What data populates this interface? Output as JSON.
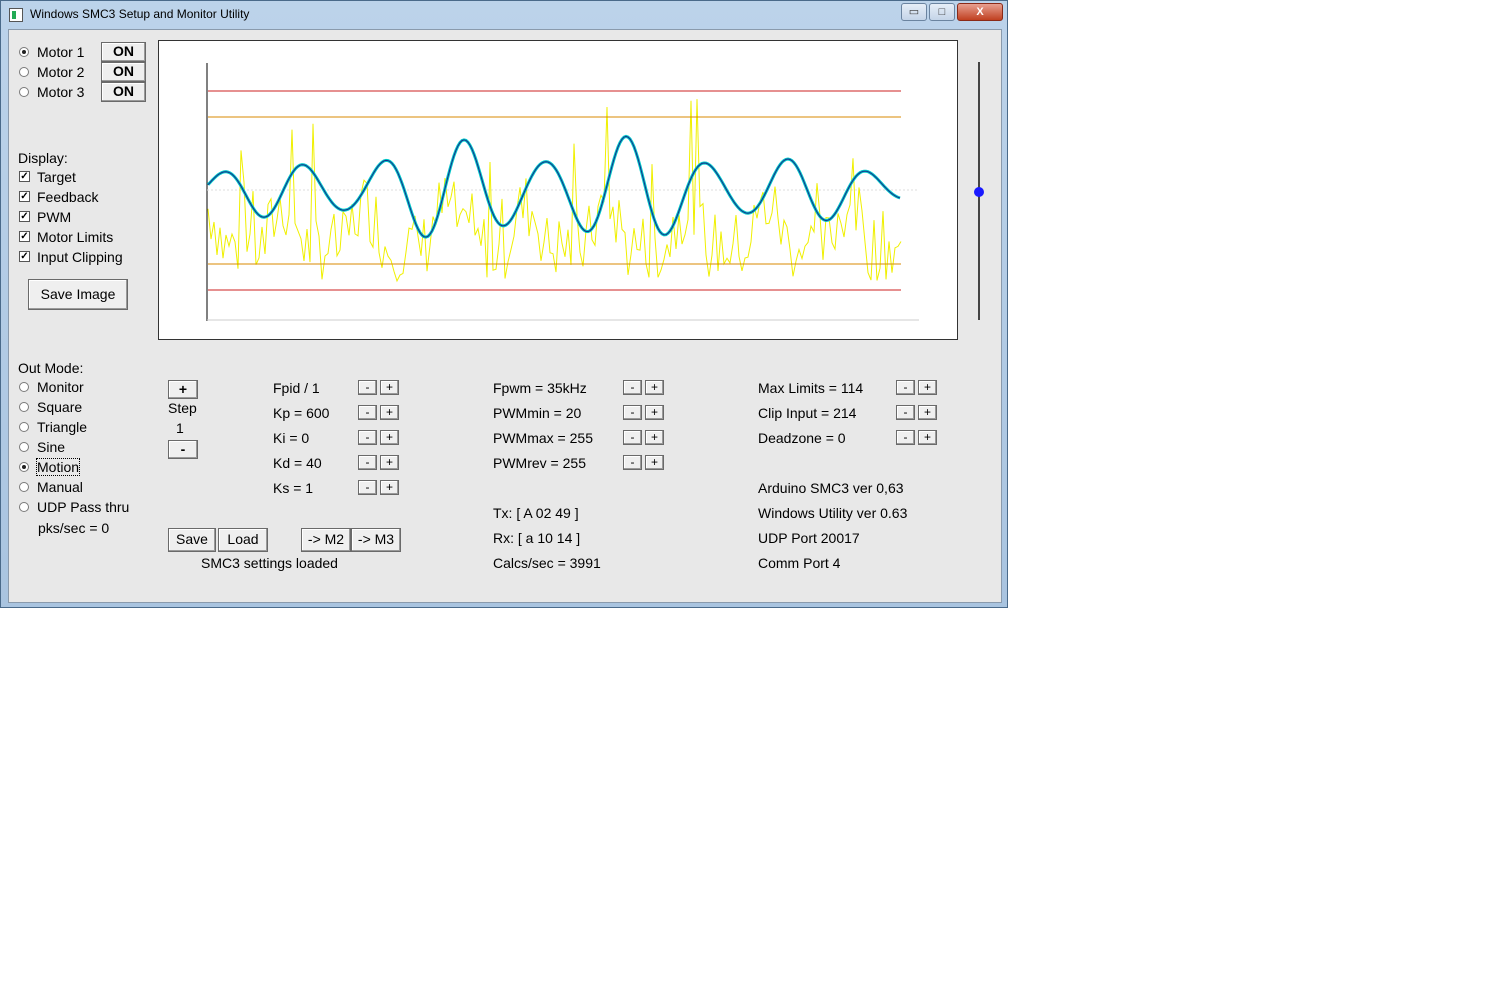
{
  "window": {
    "title": "Windows SMC3 Setup and Monitor Utility",
    "minimize": "▭",
    "maximize": "□",
    "close": "X"
  },
  "motors": [
    {
      "label": "Motor 1",
      "selected": true,
      "button": "ON"
    },
    {
      "label": "Motor 2",
      "selected": false,
      "button": "ON"
    },
    {
      "label": "Motor 3",
      "selected": false,
      "button": "ON"
    }
  ],
  "display": {
    "heading": "Display:",
    "options": [
      "Target",
      "Feedback",
      "PWM",
      "Motor Limits",
      "Input Clipping"
    ],
    "check_mark": "✓",
    "save_image": "Save Image"
  },
  "out_mode": {
    "heading": "Out Mode:",
    "options": [
      "Monitor",
      "Square",
      "Triangle",
      "Sine",
      "Motion",
      "Manual",
      "UDP Pass thru"
    ],
    "selected": "Motion",
    "pks": "pks/sec = 0"
  },
  "step": {
    "plus": "+",
    "label": "Step",
    "value": "1",
    "minus": "-"
  },
  "pid": [
    "Fpid / 1",
    "Kp = 600",
    "Ki = 0",
    "Kd = 40",
    "Ks = 1"
  ],
  "pwm": [
    "Fpwm = 35kHz",
    "PWMmin = 20",
    "PWMmax = 255",
    "PWMrev = 255"
  ],
  "limits": [
    "Max Limits = 114",
    "Clip Input = 214",
    "Deadzone = 0"
  ],
  "spin": {
    "minus": "-",
    "plus": "+"
  },
  "comms": {
    "tx": "Tx: [ A 02 49 ]",
    "rx": "Rx: [ a 10 14 ]",
    "calcs": "Calcs/sec = 3991"
  },
  "info": [
    "Arduino SMC3 ver 0,63",
    "Windows Utility ver 0.63",
    "UDP Port 20017",
    "Comm Port 4"
  ],
  "buttons": {
    "save": "Save",
    "load": "Load",
    "to_m2": "-> M2",
    "to_m3": "-> M3"
  },
  "status": "SMC3 settings loaded",
  "colors": {
    "target": "#00c8c8",
    "feedback": "#1a2a8a",
    "pwm": "#f0f000",
    "limits": "#cc2020",
    "clipping": "#d88a00",
    "slider_knob": "#1a1aff"
  }
}
